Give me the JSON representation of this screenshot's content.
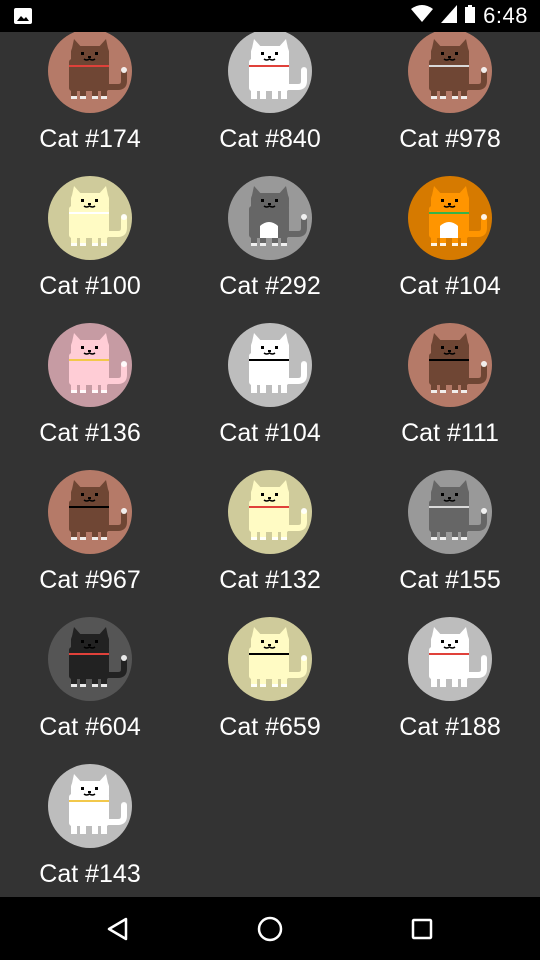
{
  "status_bar": {
    "time": "6:48",
    "icons": [
      "image-icon",
      "wifi-icon",
      "cell-signal-icon",
      "battery-icon"
    ]
  },
  "cats": [
    {
      "label": "Cat #174",
      "bg": "#b57a68",
      "body": "#6f4634",
      "face": "#000000",
      "collar": "#e0413a",
      "belly": null
    },
    {
      "label": "Cat #840",
      "bg": "#bdbdbd",
      "body": "#ffffff",
      "face": "#000000",
      "collar": "#e0413a",
      "belly": null
    },
    {
      "label": "Cat #978",
      "bg": "#b57a68",
      "body": "#6f4634",
      "face": "#000000",
      "collar": "#d9d9d9",
      "belly": null
    },
    {
      "label": "Cat #100",
      "bg": "#cfcb9b",
      "body": "#fffbc4",
      "face": "#000000",
      "collar": "#ffffff",
      "belly": null
    },
    {
      "label": "Cat #292",
      "bg": "#999999",
      "body": "#666666",
      "face": "#000000",
      "collar": null,
      "belly": "#ffffff"
    },
    {
      "label": "Cat #104",
      "bg": "#d67a00",
      "body": "#ff9500",
      "face": "#000000",
      "collar": "#36b34a",
      "belly": "#ffffff"
    },
    {
      "label": "Cat #136",
      "bg": "#c69ba3",
      "body": "#ffcdd6",
      "face": "#000000",
      "collar": "#f2c84b",
      "belly": null
    },
    {
      "label": "Cat #104",
      "bg": "#bdbdbd",
      "body": "#ffffff",
      "face": "#000000",
      "collar": "#000000",
      "belly": null
    },
    {
      "label": "Cat #111",
      "bg": "#b57a68",
      "body": "#6f4634",
      "face": "#000000",
      "collar": "#000000",
      "belly": null
    },
    {
      "label": "Cat #967",
      "bg": "#b57a68",
      "body": "#6f4634",
      "face": "#000000",
      "collar": "#000000",
      "belly": null
    },
    {
      "label": "Cat #132",
      "bg": "#cfcb9b",
      "body": "#fffbc4",
      "face": "#000000",
      "collar": "#e0413a",
      "belly": null
    },
    {
      "label": "Cat #155",
      "bg": "#999999",
      "body": "#666666",
      "face": "#000000",
      "collar": "#d9d9d9",
      "belly": null
    },
    {
      "label": "Cat #604",
      "bg": "#555555",
      "body": "#222222",
      "face": "#000000",
      "collar": "#e0413a",
      "belly": null
    },
    {
      "label": "Cat #659",
      "bg": "#cfcb9b",
      "body": "#fffbc4",
      "face": "#000000",
      "collar": "#000000",
      "belly": null
    },
    {
      "label": "Cat #188",
      "bg": "#bdbdbd",
      "body": "#ffffff",
      "face": "#000000",
      "collar": "#e0413a",
      "belly": null
    },
    {
      "label": "Cat #143",
      "bg": "#bdbdbd",
      "body": "#ffffff",
      "face": "#000000",
      "collar": "#f2c84b",
      "belly": null
    }
  ],
  "nav_bar": {
    "back_icon": "back-triangle-icon",
    "home_icon": "home-circle-icon",
    "recents_icon": "recents-square-icon"
  },
  "colors": {
    "background": "#333333",
    "label_text": "#ffffff",
    "bars": "#000000"
  }
}
